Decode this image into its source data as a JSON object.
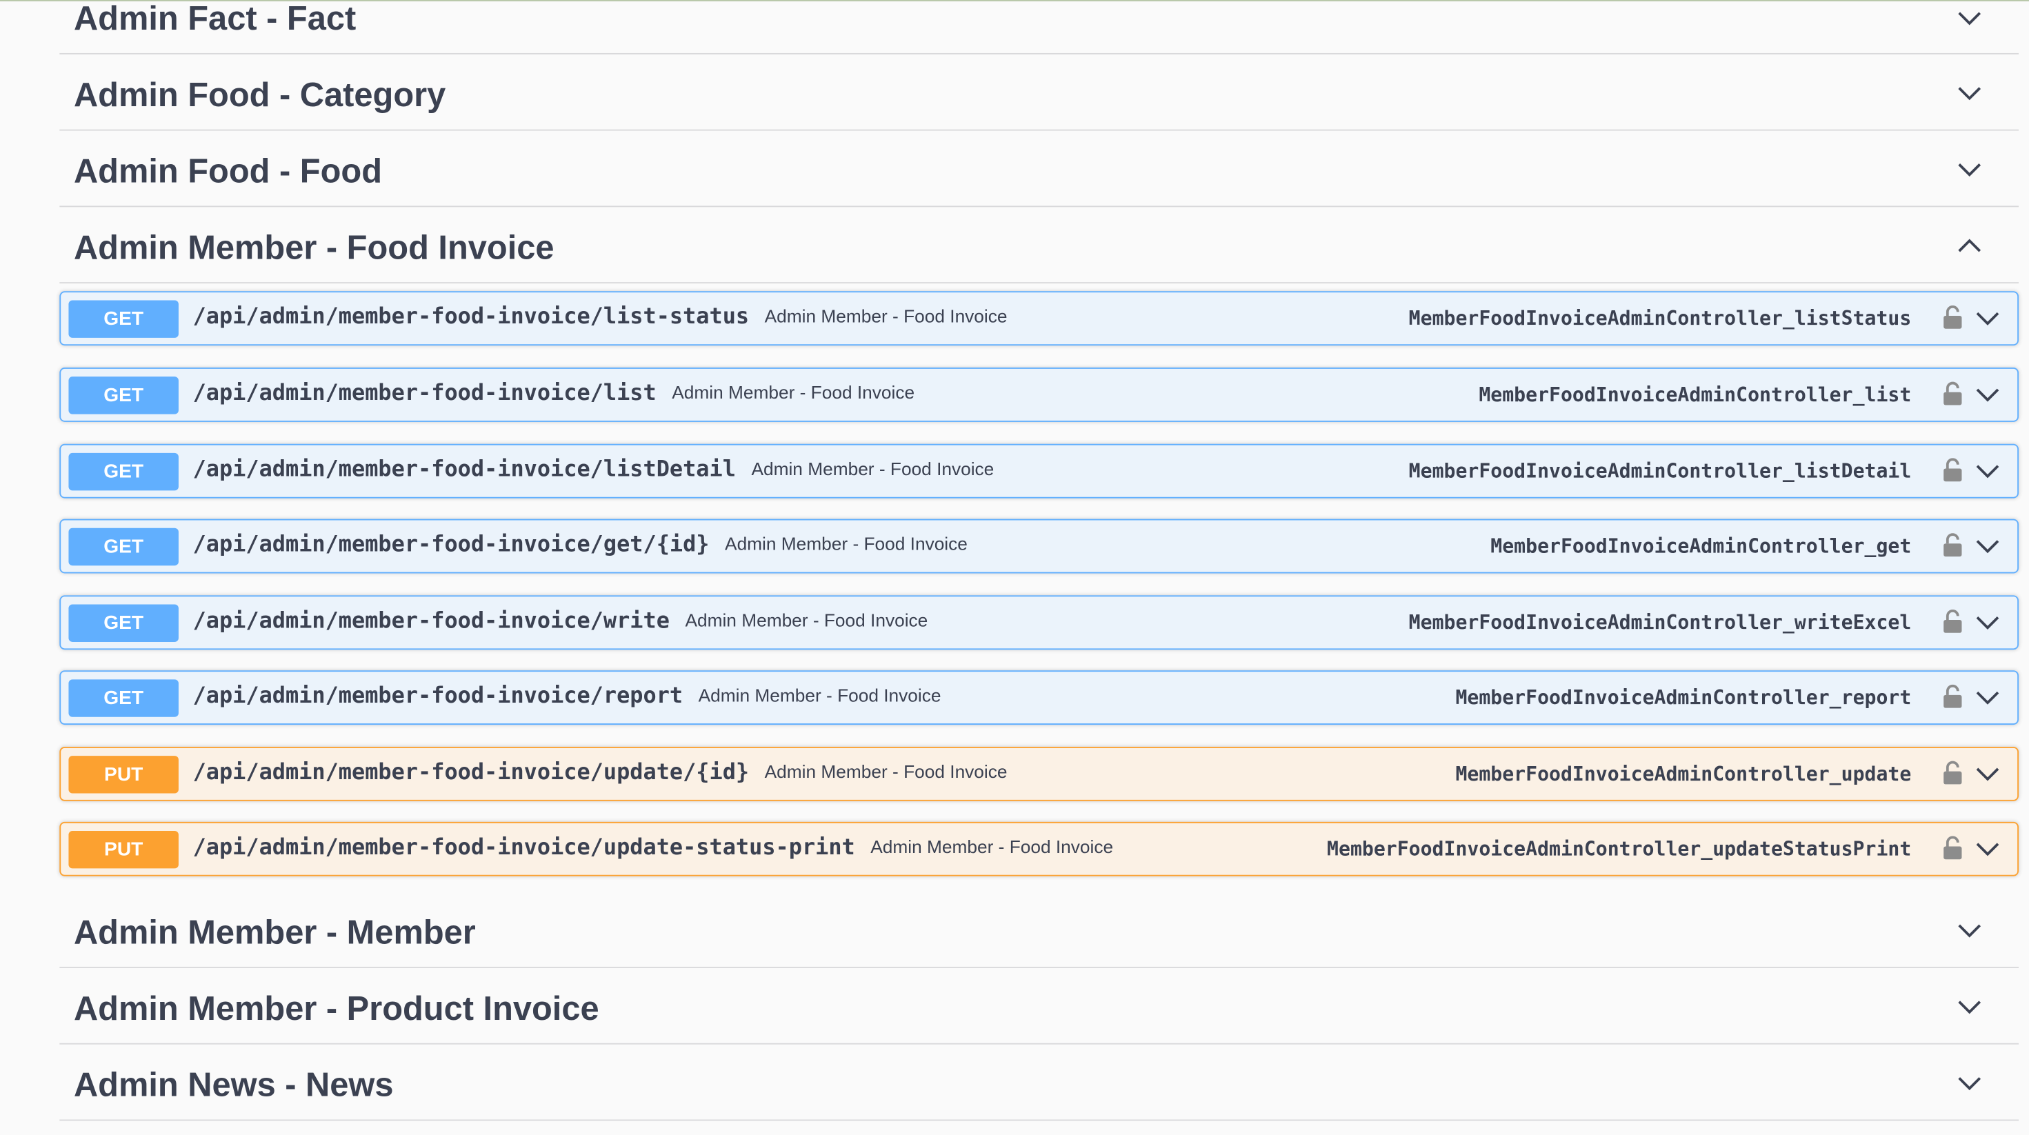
{
  "tags_before": [
    {
      "title": "Admin Fact - Fact",
      "state": "collapsed"
    },
    {
      "title": "Admin Food - Category",
      "state": "collapsed"
    },
    {
      "title": "Admin Food - Food",
      "state": "collapsed"
    }
  ],
  "expanded_tag": {
    "title": "Admin Member - Food Invoice",
    "state": "expanded",
    "operations": [
      {
        "method": "GET",
        "path": "/api/admin/member-food-invoice/list-status",
        "description": "Admin Member - Food Invoice",
        "operation_id": "MemberFoodInvoiceAdminController_listStatus",
        "color": "#61affe"
      },
      {
        "method": "GET",
        "path": "/api/admin/member-food-invoice/list",
        "description": "Admin Member - Food Invoice",
        "operation_id": "MemberFoodInvoiceAdminController_list",
        "color": "#61affe"
      },
      {
        "method": "GET",
        "path": "/api/admin/member-food-invoice/listDetail",
        "description": "Admin Member - Food Invoice",
        "operation_id": "MemberFoodInvoiceAdminController_listDetail",
        "color": "#61affe"
      },
      {
        "method": "GET",
        "path": "/api/admin/member-food-invoice/get/{id}",
        "description": "Admin Member - Food Invoice",
        "operation_id": "MemberFoodInvoiceAdminController_get",
        "color": "#61affe"
      },
      {
        "method": "GET",
        "path": "/api/admin/member-food-invoice/write",
        "description": "Admin Member - Food Invoice",
        "operation_id": "MemberFoodInvoiceAdminController_writeExcel",
        "color": "#61affe"
      },
      {
        "method": "GET",
        "path": "/api/admin/member-food-invoice/report",
        "description": "Admin Member - Food Invoice",
        "operation_id": "MemberFoodInvoiceAdminController_report",
        "color": "#61affe"
      },
      {
        "method": "PUT",
        "path": "/api/admin/member-food-invoice/update/{id}",
        "description": "Admin Member - Food Invoice",
        "operation_id": "MemberFoodInvoiceAdminController_update",
        "color": "#fca130"
      },
      {
        "method": "PUT",
        "path": "/api/admin/member-food-invoice/update-status-print",
        "description": "Admin Member - Food Invoice",
        "operation_id": "MemberFoodInvoiceAdminController_updateStatusPrint",
        "color": "#fca130"
      }
    ]
  },
  "tags_after": [
    {
      "title": "Admin Member - Member",
      "state": "collapsed"
    },
    {
      "title": "Admin Member - Product Invoice",
      "state": "collapsed"
    },
    {
      "title": "Admin News - News",
      "state": "collapsed"
    }
  ],
  "icons": {
    "tag_toggle": "chevron-icon",
    "auth": "lock-icon"
  }
}
